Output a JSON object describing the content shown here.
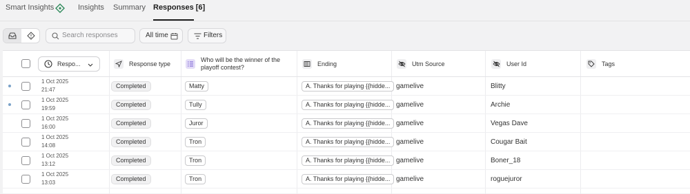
{
  "tabs": [
    {
      "label": "Smart Insights"
    },
    {
      "label": "Insights"
    },
    {
      "label": "Summary"
    },
    {
      "label": "Responses [6]"
    }
  ],
  "toolbar": {
    "search_placeholder": "Search responses",
    "date_filter_label": "All time",
    "filters_label": "Filters"
  },
  "columns": {
    "sort_col": "Respo...",
    "response_type": "Response type",
    "question": "Who will be the winner of the playoff contest?",
    "ending": "Ending",
    "utm_source": "Utm Source",
    "user_id": "User Id",
    "tags": "Tags"
  },
  "rows": [
    {
      "date": "1 Oct 2025",
      "time": "21:47",
      "unread": true,
      "type": "Completed",
      "answer": "Matty",
      "ending": "A. Thanks for playing {{hidde...",
      "utm": "gamelive",
      "user": "Blitty"
    },
    {
      "date": "1 Oct 2025",
      "time": "19:59",
      "unread": true,
      "type": "Completed",
      "answer": "Tully",
      "ending": "A. Thanks for playing {{hidde...",
      "utm": "gamelive",
      "user": "Archie"
    },
    {
      "date": "1 Oct 2025",
      "time": "16:00",
      "unread": false,
      "type": "Completed",
      "answer": "Juror",
      "ending": "A. Thanks for playing {{hidde...",
      "utm": "gamelive",
      "user": "Vegas Dave"
    },
    {
      "date": "1 Oct 2025",
      "time": "14:08",
      "unread": false,
      "type": "Completed",
      "answer": "Tron",
      "ending": "A. Thanks for playing {{hidde...",
      "utm": "gamelive",
      "user": "Cougar Bait"
    },
    {
      "date": "1 Oct 2025",
      "time": "13:12",
      "unread": false,
      "type": "Completed",
      "answer": "Tron",
      "ending": "A. Thanks for playing {{hidde...",
      "utm": "gamelive",
      "user": "Boner_18"
    },
    {
      "date": "1 Oct 2025",
      "time": "13:03",
      "unread": false,
      "type": "Completed",
      "answer": "Tron",
      "ending": "A. Thanks for playing {{hidde...",
      "utm": "gamelive",
      "user": "roguejuror"
    }
  ],
  "colors": {
    "accent_unread": "#7aa2c8",
    "question_icon_bg": "#e3dcf7"
  }
}
